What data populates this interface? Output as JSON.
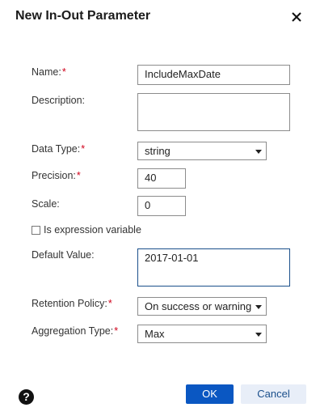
{
  "dialog": {
    "title": "New In-Out Parameter",
    "close_icon": "close-icon"
  },
  "fields": {
    "name": {
      "label": "Name:",
      "required": "*",
      "value": "IncludeMaxDate"
    },
    "description": {
      "label": "Description:",
      "value": ""
    },
    "data_type": {
      "label": "Data Type:",
      "required": "*",
      "value": "string"
    },
    "precision": {
      "label": "Precision:",
      "required": "*",
      "value": "40"
    },
    "scale": {
      "label": "Scale:",
      "value": "0"
    },
    "is_expression": {
      "label": "Is expression variable",
      "checked": false
    },
    "default_value": {
      "label": "Default Value:",
      "value": "2017-01-01"
    },
    "retention_policy": {
      "label": "Retention Policy:",
      "required": "*",
      "value": "On success or warning"
    },
    "aggregation_type": {
      "label": "Aggregation Type:",
      "required": "*",
      "value": "Max"
    }
  },
  "footer": {
    "help_icon": "help-icon",
    "help_glyph": "?",
    "ok_label": "OK",
    "cancel_label": "Cancel"
  },
  "colors": {
    "required": "#d0021b",
    "ok_button": "#0a57c2",
    "cancel_button_bg": "#e8eef8",
    "focus_border": "#1a4f8b"
  }
}
